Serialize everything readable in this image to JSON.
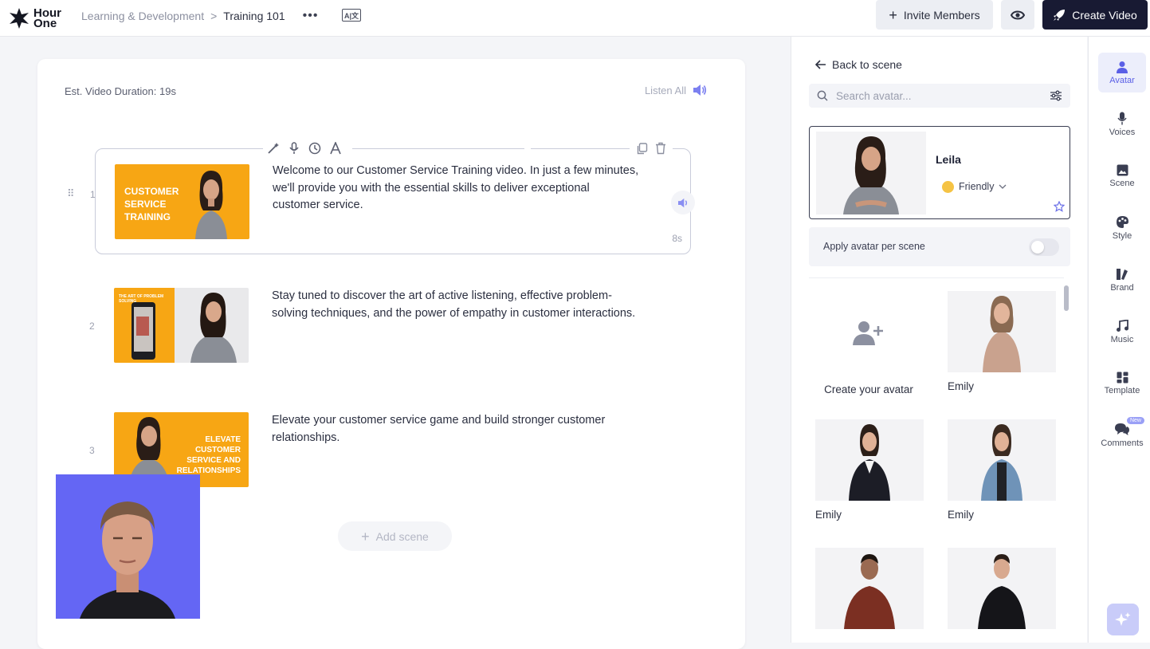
{
  "header": {
    "logo_text_line1": "Hour",
    "logo_text_line2": "One",
    "breadcrumb_parent": "Learning & Development",
    "breadcrumb_separator": ">",
    "breadcrumb_current": "Training 101",
    "more_label": "•••",
    "language_icon_text": "A|文",
    "invite_label": "Invite Members",
    "create_label": "Create Video"
  },
  "editor": {
    "duration_text": "Est. Video Duration: 19s",
    "listen_all_label": "Listen All",
    "add_scene_label": "Add scene",
    "scenes": [
      {
        "number": "1",
        "thumb_title": "Customer Service Training",
        "text": "Welcome to our Customer Service Training video. In just a few minutes, we'll provide you with the essential skills to deliver exceptional customer service.",
        "time": "8s"
      },
      {
        "number": "2",
        "thumb_title": "The art of problem solving",
        "text": "Stay tuned to discover the art of active listening, effective problem-solving techniques, and the power of empathy in customer interactions."
      },
      {
        "number": "3",
        "thumb_title": "Elevate Customer Service and Relationships",
        "text": "Elevate your customer service game and build stronger customer relationships."
      }
    ]
  },
  "panel": {
    "back_label": "Back to scene",
    "search_placeholder": "Search avatar...",
    "selected_name": "Leila",
    "selected_mood": "Friendly",
    "apply_label": "Apply avatar per scene",
    "create_avatar_label": "Create your avatar",
    "avatars": [
      {
        "name": "Emily"
      },
      {
        "name": "Emily"
      },
      {
        "name": "Emily"
      }
    ]
  },
  "rail": {
    "items": [
      {
        "label": "Avatar",
        "icon": "person-icon"
      },
      {
        "label": "Voices",
        "icon": "microphone-icon"
      },
      {
        "label": "Scene",
        "icon": "image-icon"
      },
      {
        "label": "Style",
        "icon": "palette-icon"
      },
      {
        "label": "Brand",
        "icon": "brand-icon"
      },
      {
        "label": "Music",
        "icon": "music-note-icon"
      },
      {
        "label": "Template",
        "icon": "template-icon"
      },
      {
        "label": "Comments",
        "icon": "comments-icon"
      }
    ],
    "new_badge": "New"
  },
  "colors": {
    "accent": "#5a5fe6",
    "primary_dark": "#181a33",
    "thumb_orange": "#f7a614",
    "webcam_blue": "#6466f4"
  }
}
